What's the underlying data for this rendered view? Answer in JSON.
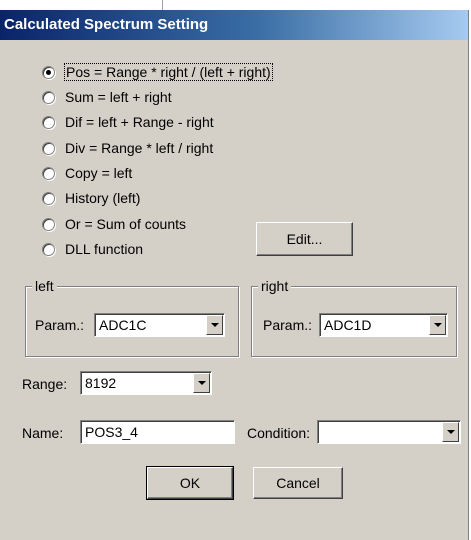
{
  "dialog": {
    "title": "Calculated Spectrum Setting"
  },
  "formulas": [
    {
      "label": "Pos = Range * right / (left + right)",
      "checked": true
    },
    {
      "label": "Sum = left + right",
      "checked": false
    },
    {
      "label": "Dif = left + Range - right",
      "checked": false
    },
    {
      "label": "Div = Range * left / right",
      "checked": false
    },
    {
      "label": "Copy = left",
      "checked": false
    },
    {
      "label": "History (left)",
      "checked": false
    },
    {
      "label": "Or = Sum of counts",
      "checked": false
    },
    {
      "label": "DLL function",
      "checked": false
    }
  ],
  "buttons": {
    "edit": "Edit...",
    "ok": "OK",
    "cancel": "Cancel"
  },
  "left_group": {
    "caption": "left",
    "param_label": "Param.:",
    "param_value": "ADC1C"
  },
  "right_group": {
    "caption": "right",
    "param_label": "Param.:",
    "param_value": "ADC1D"
  },
  "range": {
    "label": "Range:",
    "value": "8192"
  },
  "name": {
    "label": "Name:",
    "value": "POS3_4"
  },
  "condition": {
    "label": "Condition:",
    "value": ""
  }
}
